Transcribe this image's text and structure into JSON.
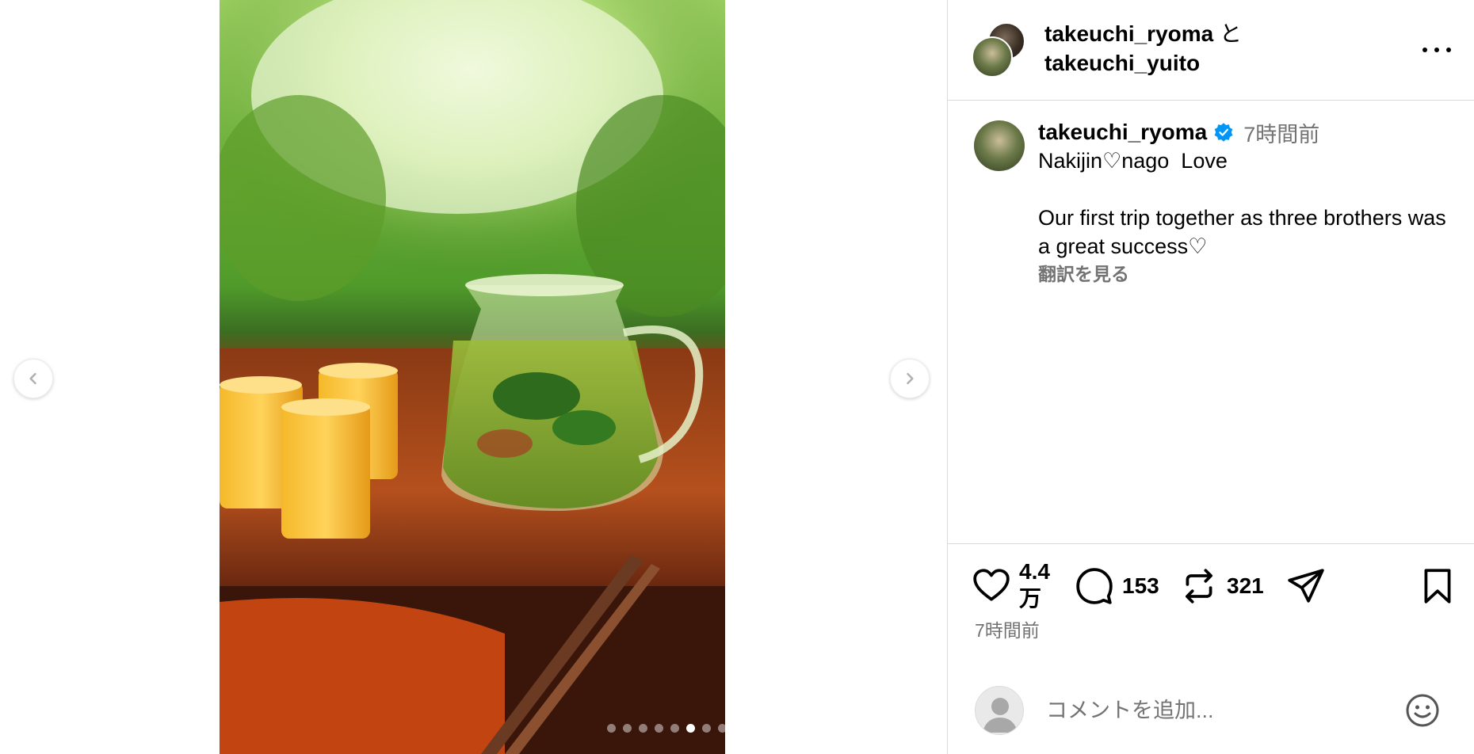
{
  "post": {
    "dots_count": 11,
    "active_dot": 5
  },
  "header": {
    "user1": "takeuchi_ryoma",
    "and": " と",
    "user2": "takeuchi_yuito"
  },
  "caption": {
    "username": "takeuchi_ryoma",
    "time": "7時間前",
    "text": "Nakijin♡nago  Love\n\nOur first trip together as three brothers was a great success♡",
    "translate_label": "翻訳を見る"
  },
  "actions": {
    "likes": "4.4\n万",
    "comments": "153",
    "reposts": "321",
    "posted_time": "7時間前"
  },
  "comment_box": {
    "placeholder": "コメントを追加..."
  },
  "colors": {
    "verified": "#0095f6",
    "muted": "#737373",
    "border": "#dbdbdb"
  },
  "icons": [
    "chevron-left-icon",
    "chevron-right-icon",
    "more-icon",
    "verified-icon",
    "heart-icon",
    "comment-icon",
    "repost-icon",
    "share-icon",
    "bookmark-icon",
    "user-icon",
    "emoji-icon"
  ]
}
